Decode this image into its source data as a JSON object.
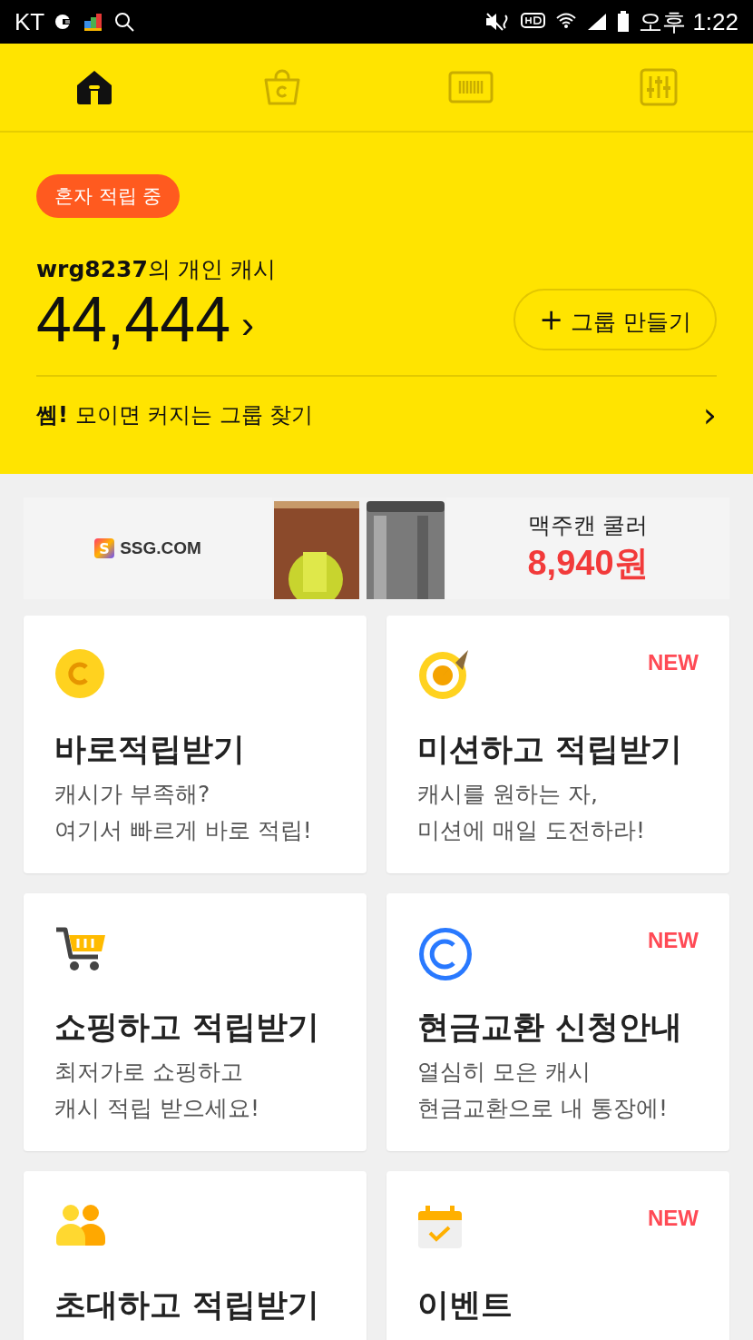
{
  "status_bar": {
    "carrier": "KT",
    "time": "오후 1:22"
  },
  "nav_tabs": [
    {
      "kind": "home",
      "selected": true
    },
    {
      "kind": "shop",
      "selected": false
    },
    {
      "kind": "barcode",
      "selected": false
    },
    {
      "kind": "settings",
      "selected": false
    }
  ],
  "account": {
    "badge": "혼자 적립 중",
    "owner": "wrg8237",
    "owner_suffix": "의 개인 캐시",
    "balance": "44,444",
    "chevron": "›",
    "group_button": "그룹 만들기",
    "group_icon": "+"
  },
  "find_group": {
    "brand": "쎔!",
    "text": "모이면 커지는 그룹 찾기",
    "chevron": "›"
  },
  "banner": {
    "logo_letter": "S",
    "logo_text": "SSG.COM",
    "product": "맥주캔 쿨러",
    "price": "8,940원"
  },
  "cards": [
    {
      "kind": "coin",
      "title": "바로적립받기",
      "lines": [
        "캐시가 부족해?",
        "여기서 빠르게 바로 적립!"
      ]
    },
    {
      "kind": "target",
      "new_label": "NEW",
      "title": "미션하고 적립받기",
      "lines": [
        "캐시를 원하는 자,",
        "미션에 매일 도전하라!"
      ]
    },
    {
      "kind": "cart",
      "title": "쇼핑하고 적립받기",
      "lines": [
        "최저가로 쇼핑하고",
        "캐시 적립 받으세요!"
      ]
    },
    {
      "kind": "copyright",
      "new_label": "NEW",
      "title": "현금교환 신청안내",
      "lines": [
        "열심히 모은 캐시",
        "현금교환으로 내 통장에!"
      ]
    },
    {
      "kind": "people",
      "title": "초대하고 적립받기"
    },
    {
      "kind": "calendar",
      "new_label": "NEW",
      "title": "이벤트"
    }
  ]
}
